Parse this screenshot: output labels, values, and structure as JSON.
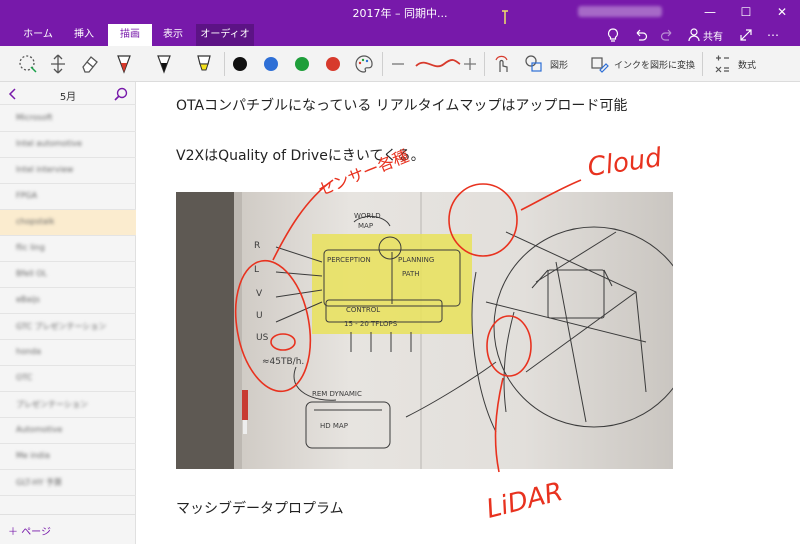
{
  "window": {
    "title": "2017年 – 同期中...",
    "minimize_glyph": "—",
    "maximize_glyph": "☐",
    "close_glyph": "✕"
  },
  "ribbon": {
    "tabs": [
      {
        "label": "ホーム"
      },
      {
        "label": "挿入"
      },
      {
        "label": "描画"
      },
      {
        "label": "表示"
      },
      {
        "label": "オーディオ"
      }
    ],
    "active_tab": "描画",
    "share_label": "共有",
    "more_glyph": "⋯"
  },
  "toolbar": {
    "shapes_label": "図形",
    "ink_to_shape_label": "インクを図形に変換",
    "math_label": "数式",
    "colors": [
      "#111111",
      "#2e6fd6",
      "#1e9e3a",
      "#d73a2c"
    ]
  },
  "sidebar": {
    "month": "5月",
    "pages": [
      "Microsoft",
      "Intel automotive",
      "Intel interview",
      "FPGA",
      "chopstalk",
      "flic ling",
      "Bfell OL",
      "eBaijs",
      "GTC プレゼンテーション",
      "honda",
      "OTC",
      "プレゼンテーション",
      "Automotive",
      "Me india",
      "GLT-HY 予算"
    ],
    "selected_index": 4,
    "add_page_label": "ページ"
  },
  "page": {
    "line1": "OTAコンパチブルになっている リアルタイムマップはアップロード可能",
    "line2": "V2XはQuality of Driveにきいてくる。",
    "line3": "マッシブデータプロプラム"
  },
  "whiteboard": {
    "world_label": "WORLD",
    "map_label": "MAP",
    "perception_label": "PERCEPTION",
    "planning_label": "PLANNING",
    "control_label": "CONTROL",
    "tflops_label": "15 - 20 TFLOPS",
    "path_label": "PATH",
    "rem_label": "REM DYNAMIC",
    "hdmap_label": "HD MAP",
    "rate_label": "≈45TB/h.",
    "sensor_letters": [
      "R",
      "L",
      "V",
      "U",
      "US"
    ]
  },
  "ink": {
    "cloud_label": "Cloud",
    "lidar_label": "LiDAR",
    "sensor_label": "センサー各種",
    "color": "#e8321f"
  }
}
